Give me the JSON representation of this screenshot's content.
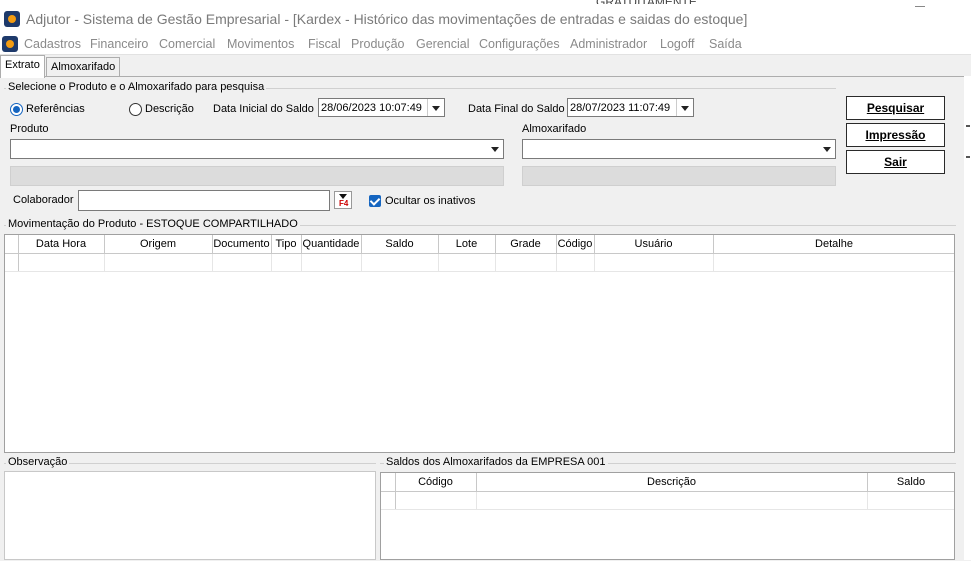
{
  "window": {
    "title": "Adjutor - Sistema de Gestão Empresarial - [Kardex - Histórico das movimentações de entradas e saidas do estoque]",
    "background_leak_text": "GRATUITAMENTE"
  },
  "menu": {
    "items": [
      "Cadastros",
      "Financeiro",
      "Comercial",
      "Movimentos",
      "Fiscal",
      "Produção",
      "Gerencial",
      "Configurações",
      "Administrador",
      "Logoff",
      "Saída"
    ]
  },
  "tabs": [
    {
      "label": "Extrato",
      "active": true
    },
    {
      "label": "Almoxarifado",
      "active": false
    }
  ],
  "search": {
    "group_title": "Selecione o Produto e  o Almoxarifado para pesquisa",
    "radio_referencias": "Referências",
    "radio_descricao": "Descrição",
    "radio_selected": "Referências",
    "data_inicial_label": "Data Inicial do Saldo :",
    "data_inicial_value": "28/06/2023 10:07:49",
    "data_final_label": "Data Final do Saldo :",
    "data_final_value": "28/07/2023 11:07:49",
    "produto_label": "Produto",
    "almoxarifado_label": "Almoxarifado",
    "colaborador_label": "Colaborador",
    "ocultar_inativos_label": "Ocultar os inativos",
    "ocultar_inativos_checked": true,
    "f4_text": "F4"
  },
  "buttons": {
    "pesquisar": "Pesquisar",
    "impressao": "Impressão",
    "sair": "Sair"
  },
  "movimentacao": {
    "group_title": "Movimentação do Produto - ESTOQUE COMPARTILHADO",
    "columns": [
      "Data Hora",
      "Origem",
      "Documento",
      "Tipo",
      "Quantidade",
      "Saldo",
      "Lote",
      "Grade",
      "Código",
      "Usuário",
      "Detalhe"
    ]
  },
  "observacao": {
    "group_title": "Observação"
  },
  "saldos": {
    "group_title": "Saldos dos Almoxarifados da EMPRESA 001",
    "columns": [
      "Código",
      "Descrição",
      "Saldo"
    ]
  },
  "colors": {
    "accent": "#1565c0",
    "window_bg": "#f0f0f0",
    "menu_text": "#8a8a8a",
    "title_text": "#7a7a7a"
  }
}
